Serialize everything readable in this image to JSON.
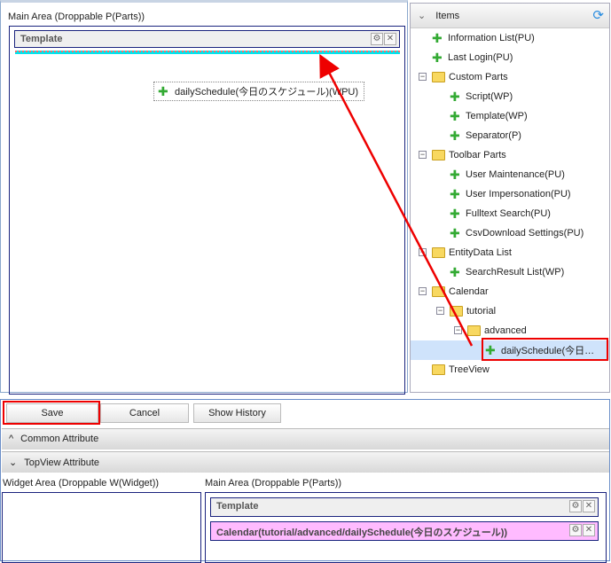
{
  "editor": {
    "main_area_label": "Main Area (Droppable P(Parts))",
    "template_part": "Template",
    "dragging_item": "dailySchedule(今日のスケジュール)(WPU)"
  },
  "items_panel": {
    "title": "Items",
    "tree": [
      {
        "label": "Information List(PU)",
        "type": "part",
        "level": 0
      },
      {
        "label": "Last Login(PU)",
        "type": "part",
        "level": 0
      },
      {
        "label": "Custom Parts",
        "type": "folder",
        "level": 0
      },
      {
        "label": "Script(WP)",
        "type": "part",
        "level": 1
      },
      {
        "label": "Template(WP)",
        "type": "part",
        "level": 1
      },
      {
        "label": "Separator(P)",
        "type": "part",
        "level": 1
      },
      {
        "label": "Toolbar Parts",
        "type": "folder",
        "level": 0
      },
      {
        "label": "User Maintenance(PU)",
        "type": "part",
        "level": 1
      },
      {
        "label": "User Impersonation(PU)",
        "type": "part",
        "level": 1
      },
      {
        "label": "Fulltext Search(PU)",
        "type": "part",
        "level": 1
      },
      {
        "label": "CsvDownload Settings(PU)",
        "type": "part",
        "level": 1
      },
      {
        "label": "EntityData List",
        "type": "folder",
        "level": 0
      },
      {
        "label": "SearchResult List(WP)",
        "type": "part",
        "level": 1
      },
      {
        "label": "Calendar",
        "type": "folder",
        "level": 0
      },
      {
        "label": "tutorial",
        "type": "folder",
        "level": 1
      },
      {
        "label": "advanced",
        "type": "folder",
        "level": 2
      },
      {
        "label": "dailySchedule(今日…",
        "type": "part",
        "level": 3,
        "selected": true
      },
      {
        "label": "TreeView",
        "type": "folder",
        "level": 0,
        "noexp": true
      }
    ]
  },
  "toolbar": {
    "save": "Save",
    "cancel": "Cancel",
    "history": "Show History"
  },
  "sections": {
    "common": "Common Attribute",
    "topview": "TopView Attribute"
  },
  "topview": {
    "widget_label": "Widget Area (Droppable W(Widget))",
    "main_label": "Main Area (Droppable P(Parts))",
    "parts": [
      "Template",
      "Calendar(tutorial/advanced/dailySchedule(今日のスケジュール))"
    ]
  },
  "colors": {
    "annotation": "#ee0000",
    "added_part": "#ffbbff",
    "drop_indicator": "#00e5ee"
  }
}
